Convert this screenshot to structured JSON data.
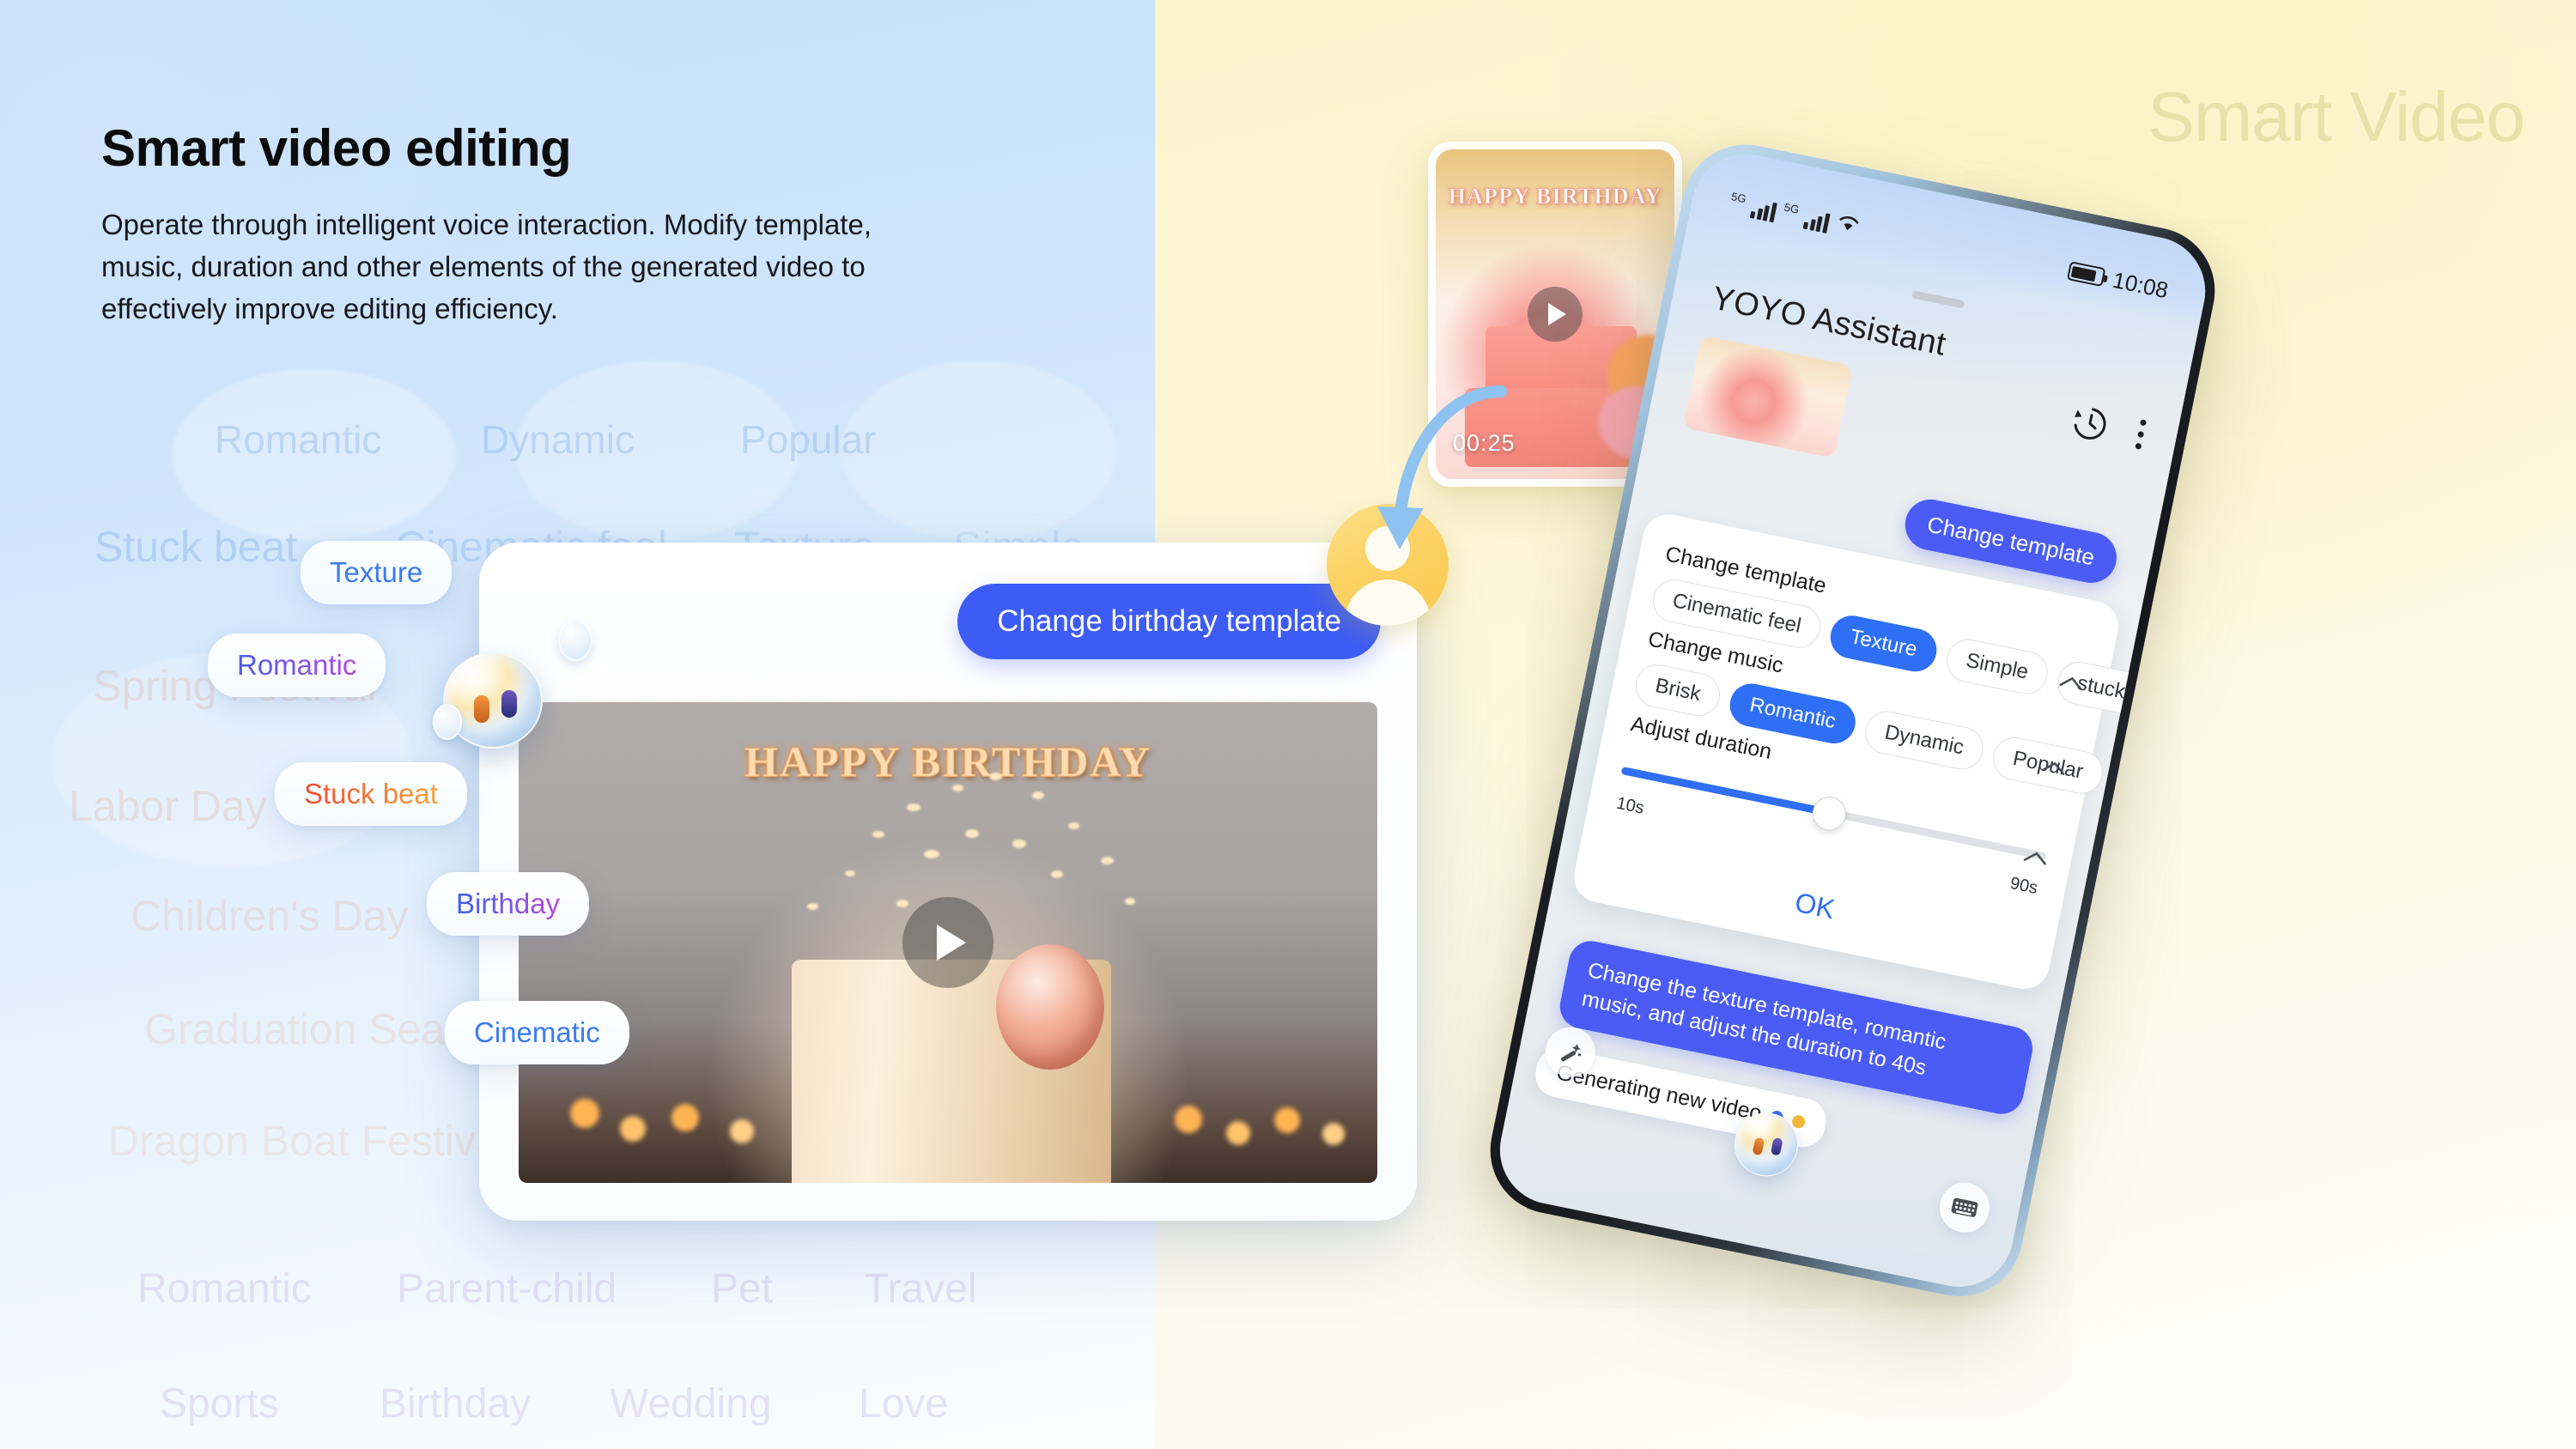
{
  "page": {
    "watermark": "Smart Video"
  },
  "headline": {
    "title": "Smart video editing",
    "body": "Operate through intelligent voice interaction. Modify template, music, duration and other elements of the generated video to effectively improve editing efficiency."
  },
  "ghost_tags": {
    "row1": [
      "Romantic",
      "Dynamic",
      "Popular"
    ],
    "row2": [
      "Stuck beat",
      "Cinematic feel",
      "Texture",
      "Simple"
    ],
    "row3": [
      "Spring Festival"
    ],
    "row4": [
      "Labor Day"
    ],
    "row5": [
      "Children's Day"
    ],
    "row6": [
      "Graduation Season"
    ],
    "row7": [
      "Dragon Boat Festival"
    ],
    "row8": [
      "Romantic",
      "Parent-child",
      "Pet",
      "Travel"
    ],
    "row9": [
      "Sports",
      "Birthday",
      "Wedding",
      "Love"
    ]
  },
  "pills": [
    {
      "label": "Texture",
      "style": "blue"
    },
    {
      "label": "Romantic",
      "style": "purple"
    },
    {
      "label": "Stuck beat",
      "style": "orange"
    },
    {
      "label": "Birthday",
      "style": "purple"
    },
    {
      "label": "Cinematic",
      "style": "blue"
    }
  ],
  "video_card": {
    "chat_bubble": "Change birthday template",
    "video_title": "HAPPY BIRTHDAY",
    "play_icon": "play-icon"
  },
  "thumb_card": {
    "title": "HAPPY BIRTHDAY",
    "duration": "00:25",
    "play_icon": "play-icon"
  },
  "phone": {
    "status_bar": {
      "network_1": "5G",
      "network_2": "5G",
      "wifi_icon": "wifi-icon",
      "battery_icon": "battery-icon",
      "time": "10:08"
    },
    "app_title": "YOYO Assistant",
    "header_icons": {
      "history": "history-icon",
      "more": "more-vertical-icon"
    },
    "messages": {
      "user_1": "Change template",
      "user_2": "Change the texture template, romantic music, and adjust the duration to 40s",
      "bot_1": "Generating new video"
    },
    "panel": {
      "template": {
        "label": "Change template",
        "options": [
          "Cinematic feel",
          "Texture",
          "Simple",
          "stuck"
        ],
        "selected": "Texture",
        "collapse_icon": "chevron-up-icon"
      },
      "music": {
        "label": "Change music",
        "options": [
          "Brisk",
          "Romantic",
          "Dynamic",
          "Popular"
        ],
        "selected": "Romantic",
        "collapse_icon": "chevron-up-icon"
      },
      "duration": {
        "label": "Adjust duration",
        "min": "10s",
        "max": "90s",
        "value_percent": 49,
        "collapse_icon": "chevron-up-icon"
      },
      "ok_label": "OK"
    },
    "bottom_bar": {
      "magic_wand": "magic-wand-icon",
      "assistant_orb": "yoyo-orb-icon",
      "keyboard": "keyboard-icon"
    }
  },
  "colors": {
    "accent_blue": "#3d5cf5",
    "chip_blue": "#2e6ff5",
    "left_bg": "#c6e0fb",
    "right_bg": "#fcf4cc",
    "watermark": "#e8e1a8"
  }
}
